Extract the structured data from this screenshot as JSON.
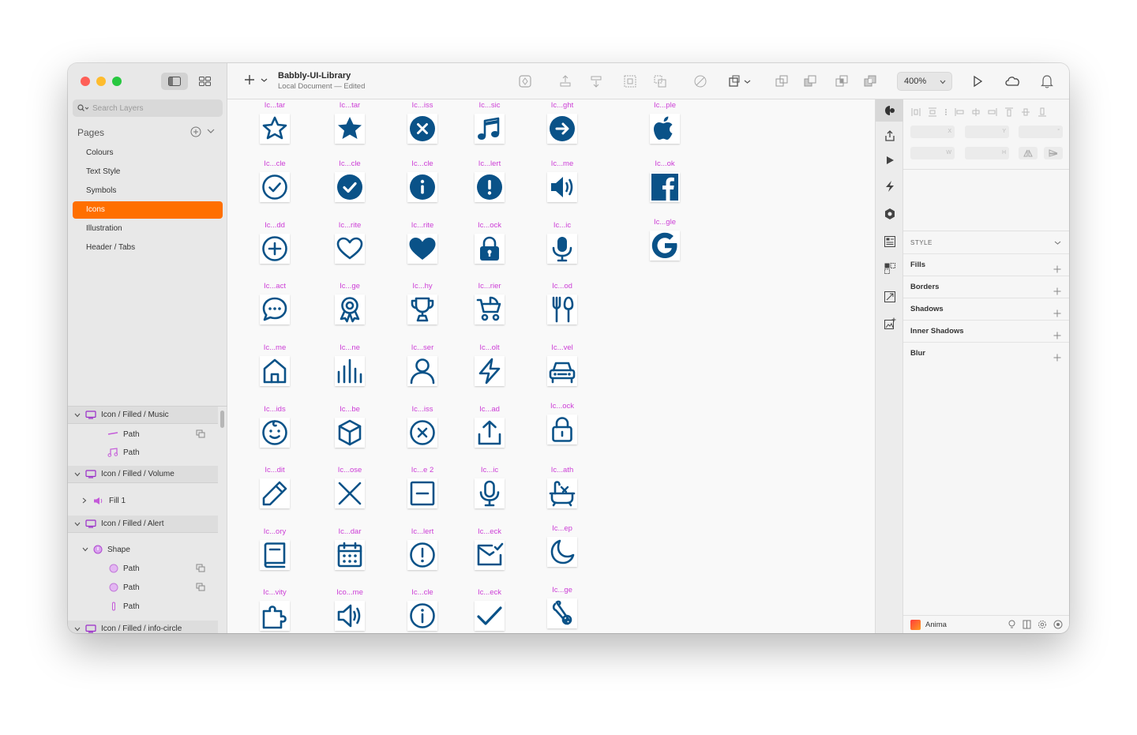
{
  "window": {
    "doc_title": "Babbly-UI-Library",
    "doc_subtitle": "Local Document — Edited",
    "zoom": "400%"
  },
  "sidebar": {
    "search_placeholder": "Search Layers",
    "pages_label": "Pages",
    "pages": [
      "Colours",
      "Text Style",
      "Symbols",
      "Icons",
      "Illustration",
      "Header / Tabs"
    ],
    "active_page": "Icons",
    "layers": [
      {
        "label": "Icon / Filled / Music",
        "kind": "group",
        "icon": "artboard-icon"
      },
      {
        "label": "Path",
        "kind": "child",
        "icon": "path-line-icon",
        "sub": true
      },
      {
        "label": "Path",
        "kind": "child",
        "icon": "path-music-icon",
        "sub": false
      },
      {
        "label": "Icon / Filled / Volume",
        "kind": "group",
        "icon": "artboard-icon"
      },
      {
        "label": "Fill 1",
        "kind": "collapsed",
        "icon": "volume-fill-icon"
      },
      {
        "label": "Icon / Filled / Alert",
        "kind": "group",
        "icon": "artboard-icon"
      },
      {
        "label": "Shape",
        "kind": "shape",
        "icon": "shape-icon"
      },
      {
        "label": "Path",
        "kind": "deep",
        "icon": "circle-path-icon",
        "sub": true
      },
      {
        "label": "Path",
        "kind": "deep",
        "icon": "circle-path-icon",
        "sub": true
      },
      {
        "label": "Path",
        "kind": "deep",
        "icon": "bar-path-icon",
        "sub": false
      },
      {
        "label": "Icon / Filled / info-circle",
        "kind": "group",
        "icon": "artboard-icon"
      }
    ]
  },
  "canvas": {
    "accent": "#0a5288",
    "label_color": "#cc3dd6",
    "columns": [
      [
        {
          "label": "Ic...tar",
          "icon": "star-outline-icon"
        },
        {
          "label": "Ic...cle",
          "icon": "check-circle-outline-icon"
        },
        {
          "label": "Ic...dd",
          "icon": "plus-circle-outline-icon"
        },
        {
          "label": "Ic...act",
          "icon": "chat-bubble-icon"
        },
        {
          "label": "Ic...me",
          "icon": "home-outline-icon"
        },
        {
          "label": "Ic...ids",
          "icon": "baby-face-icon"
        },
        {
          "label": "Ic...dit",
          "icon": "pencil-icon"
        },
        {
          "label": "Ic...ory",
          "icon": "book-icon"
        },
        {
          "label": "Ic...vity",
          "icon": "puzzle-icon"
        }
      ],
      [
        {
          "label": "Ic...tar",
          "icon": "star-filled-icon"
        },
        {
          "label": "Ic...cle",
          "icon": "check-circle-filled-icon"
        },
        {
          "label": "Ic...rite",
          "icon": "heart-outline-icon"
        },
        {
          "label": "Ic...ge",
          "icon": "badge-ribbon-icon"
        },
        {
          "label": "Ic...ne",
          "icon": "bar-chart-icon"
        },
        {
          "label": "Ic...be",
          "icon": "cube-icon"
        },
        {
          "label": "Ic...ose",
          "icon": "close-x-icon"
        },
        {
          "label": "Ic...dar",
          "icon": "calendar-icon"
        },
        {
          "label": "Ico...me",
          "icon": "volume-outline-icon"
        }
      ],
      [
        {
          "label": "Ic...iss",
          "icon": "x-circle-filled-icon"
        },
        {
          "label": "Ic...cle",
          "icon": "info-circle-filled-icon"
        },
        {
          "label": "Ic...rite",
          "icon": "heart-filled-icon"
        },
        {
          "label": "Ic...hy",
          "icon": "trophy-icon"
        },
        {
          "label": "Ic...ser",
          "icon": "user-icon"
        },
        {
          "label": "Ic...iss",
          "icon": "x-circle-outline-icon"
        },
        {
          "label": "Ic...e 2",
          "icon": "minus-square-icon"
        },
        {
          "label": "Ic...lert",
          "icon": "alert-circle-outline-icon"
        },
        {
          "label": "Ic...cle",
          "icon": "info-circle-outline-icon"
        }
      ],
      [
        {
          "label": "Ic...sic",
          "icon": "music-note-icon"
        },
        {
          "label": "Ic...lert",
          "icon": "alert-circle-filled-icon"
        },
        {
          "label": "Ic...ock",
          "icon": "lock-filled-icon"
        },
        {
          "label": "Ic...rier",
          "icon": "stroller-icon"
        },
        {
          "label": "Ic...olt",
          "icon": "bolt-icon"
        },
        {
          "label": "Ic...ad",
          "icon": "upload-icon"
        },
        {
          "label": "Ic...ic",
          "icon": "mic-outline-icon"
        },
        {
          "label": "Ic...eck",
          "icon": "mail-check-icon"
        },
        {
          "label": "Ic...eck",
          "icon": "checkmark-icon"
        }
      ],
      [
        {
          "label": "Ic...ght",
          "icon": "arrow-right-circle-icon"
        },
        {
          "label": "Ic...me",
          "icon": "volume-filled-icon"
        },
        {
          "label": "Ic...ic",
          "icon": "mic-filled-icon"
        },
        {
          "label": "Ic...od",
          "icon": "fork-spoon-icon"
        },
        {
          "label": "Ic...vel",
          "icon": "car-icon"
        },
        {
          "label": "Ic...ock",
          "icon": "lock-outline-icon"
        },
        {
          "label": "Ic...ath",
          "icon": "bathtub-icon"
        },
        {
          "label": "Ic...ep",
          "icon": "moon-icon"
        },
        {
          "label": "Ic...ge",
          "icon": "safety-pin-icon"
        }
      ],
      [
        {
          "label": "Ic...ple",
          "icon": "apple-logo-icon"
        },
        {
          "label": "Ic...ok",
          "icon": "facebook-logo-icon"
        },
        {
          "label": "Ic...gle",
          "icon": "google-logo-icon"
        }
      ]
    ]
  },
  "inspector": {
    "fields": [
      "X",
      "Y",
      "°",
      "W",
      "H"
    ],
    "style_label": "STYLE",
    "rows": [
      "Fills",
      "Borders",
      "Shadows",
      "Inner Shadows",
      "Blur"
    ],
    "footer_label": "Anima"
  }
}
